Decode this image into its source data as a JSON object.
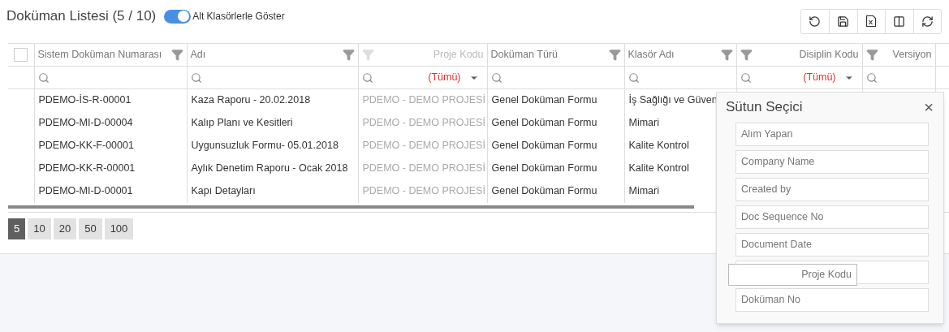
{
  "header": {
    "title": "Doküman Listesi (5 / 10)",
    "toggle": {
      "label": "Alt Klasörlerle Göster",
      "on": true
    }
  },
  "toolbar": [
    {
      "kind": "undo"
    },
    {
      "kind": "save"
    },
    {
      "kind": "excel"
    },
    {
      "kind": "columns"
    },
    {
      "kind": "refresh"
    }
  ],
  "table": {
    "select_all": {
      "checked": false
    },
    "columns": [
      {
        "label": "Sistem Doküman Numarası",
        "kind": "text",
        "disabled": false
      },
      {
        "label": "Adı",
        "kind": "text",
        "disabled": false
      },
      {
        "label": "Proje Kodu",
        "kind": "lookup",
        "disabled": true,
        "filter_value": "(Tümü)"
      },
      {
        "label": "Doküman Türü",
        "kind": "text",
        "disabled": false
      },
      {
        "label": "Klasör Adı",
        "kind": "text",
        "disabled": false
      },
      {
        "label": "Disiplin Kodu",
        "kind": "lookup",
        "disabled": false,
        "filter_value": "(Tümü)"
      },
      {
        "label": "Versiyon",
        "kind": "number",
        "disabled": false
      }
    ],
    "rows": [
      [
        "PDEMO-İS-R-00001",
        "Kaza Raporu - 20.02.2018",
        "PDEMO - DEMO PROJESİ",
        "Genel Doküman Formu",
        "İş Sağlığı ve Güven"
      ],
      [
        "PDEMO-MI-D-00004",
        "Kalıp Planı ve Kesitleri",
        "PDEMO - DEMO PROJESİ",
        "Genel Doküman Formu",
        "Mimari"
      ],
      [
        "PDEMO-KK-F-00001",
        "Uygunsuzluk Formu- 05.01.2018",
        "PDEMO - DEMO PROJESİ",
        "Genel Doküman Formu",
        "Kalite Kontrol"
      ],
      [
        "PDEMO-KK-R-00001",
        "Aylık Denetim Raporu - Ocak 2018",
        "PDEMO - DEMO PROJESİ",
        "Genel Doküman Formu",
        "Kalite Kontrol"
      ],
      [
        "PDEMO-MI-D-00001",
        "Kapı Detayları",
        "PDEMO - DEMO PROJESİ",
        "Genel Doküman Formu",
        "Mimari"
      ]
    ]
  },
  "pager": [
    {
      "label": "5",
      "selected": true
    },
    {
      "label": "10",
      "selected": false
    },
    {
      "label": "20",
      "selected": false
    },
    {
      "label": "50",
      "selected": false
    },
    {
      "label": "100",
      "selected": false
    }
  ],
  "column_chooser": {
    "title": "Sütun Seçici",
    "close": "×",
    "items": [
      {
        "kind": "item",
        "label": "Alım Yapan"
      },
      {
        "kind": "item",
        "label": "Company Name"
      },
      {
        "kind": "item",
        "label": "Created by"
      },
      {
        "kind": "item",
        "label": "Doc Sequence No"
      },
      {
        "kind": "item",
        "label": "Document Date"
      },
      {
        "kind": "slot"
      },
      {
        "kind": "item",
        "label": "Doküman No"
      }
    ],
    "dragged": {
      "label": "Proje Kodu"
    }
  }
}
